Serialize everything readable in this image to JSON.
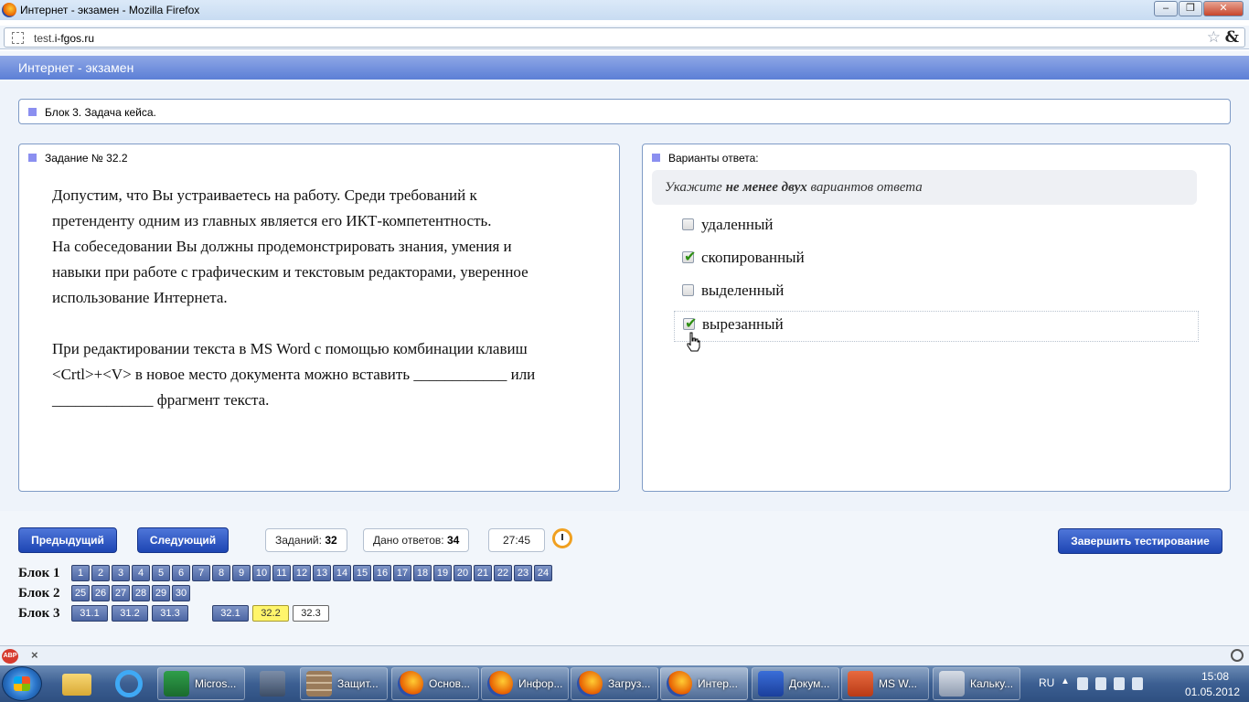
{
  "window": {
    "title": "Интернет - экзамен - Mozilla Firefox",
    "url_prefix": "test.",
    "url_domain": "i-fgos.ru",
    "url_suffix": "",
    "addon_symbol": "&"
  },
  "header": {
    "title": "Интернет - экзамен"
  },
  "block": {
    "caption": "Блок 3. Задача кейса."
  },
  "task": {
    "caption": "Задание № 32.2",
    "para1_line1": "Допустим, что Вы устраиваетесь на работу. Среди требований к",
    "para1_line2": "претенденту одним из главных является его ИКТ-компетентность.",
    "para1_line3": "На собеседовании Вы должны продемонстрировать знания, умения и",
    "para1_line4": "навыки при работе с графическим и текстовым редакторами, уверенное",
    "para1_line5": "использование Интернета.",
    "para2_line1": "При редактировании текста в MS Word с помощью комбинации клавиш",
    "para2_line2": "<Crtl>+<V> в новое место документа можно вставить ____________ или",
    "para2_line3": "_____________ фрагмент текста."
  },
  "answers": {
    "caption": "Варианты ответа:",
    "hint_before": "Укажите ",
    "hint_bold": "не менее двух",
    "hint_after": " вариантов ответа",
    "options": [
      {
        "label": "удаленный",
        "checked": false
      },
      {
        "label": "скопированный",
        "checked": true
      },
      {
        "label": "выделенный",
        "checked": false
      },
      {
        "label": "вырезанный",
        "checked": true
      }
    ]
  },
  "nav": {
    "prev_label": "Предыдущий",
    "next_label": "Следующий",
    "tasks_label": "Заданий: ",
    "tasks_value": "32",
    "answered_label": "Дано ответов: ",
    "answered_value": "34",
    "timer": "27:45",
    "finish_label": "Завершить тестирование"
  },
  "blocks": {
    "row1_label": "Блок 1",
    "row2_label": "Блок 2",
    "row3_label": "Блок 3",
    "row1": [
      "1",
      "2",
      "3",
      "4",
      "5",
      "6",
      "7",
      "8",
      "9",
      "10",
      "11",
      "12",
      "13",
      "14",
      "15",
      "16",
      "17",
      "18",
      "19",
      "20",
      "21",
      "22",
      "23",
      "24"
    ],
    "row2": [
      "25",
      "26",
      "27",
      "28",
      "29",
      "30"
    ],
    "row3": [
      "31.1",
      "31.2",
      "31.3",
      "32.1",
      "32.2",
      "32.3"
    ]
  },
  "addonbar": {
    "abp": "ABP",
    "close": "×"
  },
  "taskbar": {
    "items": [
      "Micros...",
      "Защит...",
      "Основ...",
      "Инфор...",
      "Загруз...",
      "Интер...",
      "Докум...",
      "MS W...",
      "Кальку..."
    ],
    "lang": "RU",
    "time": "15:08",
    "date": "01.05.2012"
  }
}
